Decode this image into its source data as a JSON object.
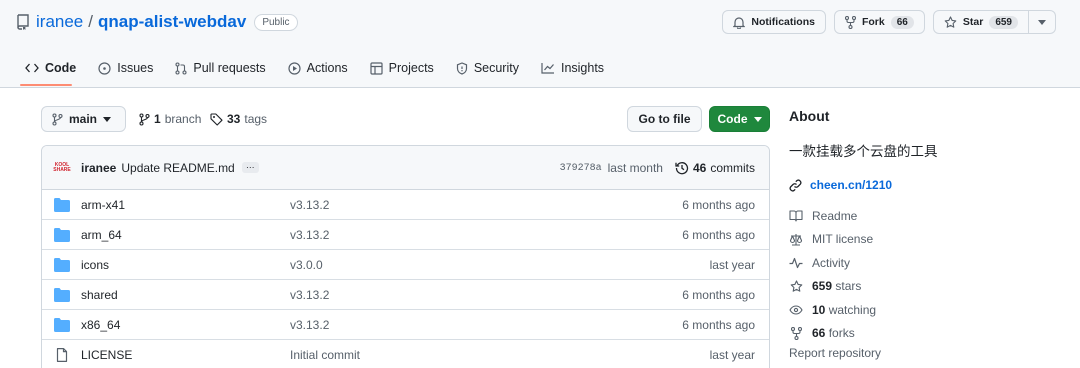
{
  "repo": {
    "owner": "iranee",
    "separator": "/",
    "name": "qnap-alist-webdav",
    "visibility": "Public"
  },
  "actions": {
    "notifications_label": "Notifications",
    "fork_label": "Fork",
    "fork_count": "66",
    "star_label": "Star",
    "star_count": "659"
  },
  "tabs": [
    {
      "label": "Code",
      "icon": "code-icon",
      "active": true
    },
    {
      "label": "Issues",
      "icon": "issue-icon"
    },
    {
      "label": "Pull requests",
      "icon": "pull-request-icon"
    },
    {
      "label": "Actions",
      "icon": "play-icon"
    },
    {
      "label": "Projects",
      "icon": "table-icon"
    },
    {
      "label": "Security",
      "icon": "shield-icon"
    },
    {
      "label": "Insights",
      "icon": "graph-icon"
    }
  ],
  "branch_bar": {
    "branch": "main",
    "branches_count": "1",
    "branches_label": "branch",
    "tags_count": "33",
    "tags_label": "tags",
    "goto_file": "Go to file",
    "code_button": "Code"
  },
  "latest_commit": {
    "avatar_text": "KOOL SHARE",
    "author": "iranee",
    "message": "Update README.md",
    "ellipsis": "…",
    "sha": "379278a",
    "time": "last month",
    "commits_count": "46",
    "commits_label": "commits"
  },
  "files": [
    {
      "name": "arm-x41",
      "type": "dir",
      "message": "v3.13.2",
      "age": "6 months ago"
    },
    {
      "name": "arm_64",
      "type": "dir",
      "message": "v3.13.2",
      "age": "6 months ago"
    },
    {
      "name": "icons",
      "type": "dir",
      "message": "v3.0.0",
      "age": "last year"
    },
    {
      "name": "shared",
      "type": "dir",
      "message": "v3.13.2",
      "age": "6 months ago"
    },
    {
      "name": "x86_64",
      "type": "dir",
      "message": "v3.13.2",
      "age": "6 months ago"
    },
    {
      "name": "LICENSE",
      "type": "file",
      "message": "Initial commit",
      "age": "last year"
    }
  ],
  "about": {
    "heading": "About",
    "description": "一款挂载多个云盘的工具",
    "website": "cheen.cn/1210",
    "readme": "Readme",
    "license": "MIT license",
    "activity": "Activity",
    "stars_count": "659",
    "stars_label": "stars",
    "watching_count": "10",
    "watching_label": "watching",
    "forks_count": "66",
    "forks_label": "forks",
    "report": "Report repository"
  },
  "colors": {
    "link": "#0969da",
    "code_button": "#1f883d",
    "folder": "#54aeff",
    "tab_underline": "#fd8c73"
  }
}
